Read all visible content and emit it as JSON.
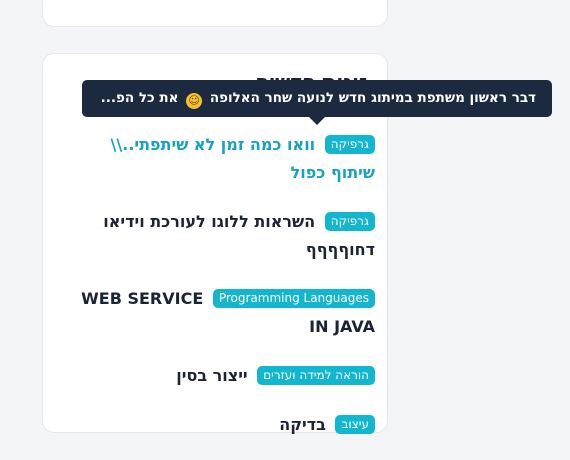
{
  "section": {
    "heading": "זוגות חדשים"
  },
  "tooltip": {
    "text_before_emoji": "דבר ראשון משתפת במיתוג חדש לנועה שחר האלופה",
    "emoji": "☺",
    "text_after_emoji": "את כל הפ..."
  },
  "items": [
    {
      "tag": "גרפיקה",
      "title": "וואו כמה זמן לא שיתפתי..\\\\ שיתוף כפול"
    },
    {
      "tag": "גרפיקה",
      "title": "השראות ללוגו לעורכת וידיאו דחוףףףף"
    },
    {
      "tag": "Programming Languages",
      "title": "WEB SERVICE IN JAVA"
    },
    {
      "tag": "הוראה למידה ועזרים",
      "title": "ייצור בסין"
    },
    {
      "tag": "עיצוב",
      "title": "בדיקה"
    }
  ],
  "colors": {
    "tag_bg": "#13b6cf",
    "link_teal": "#17a2c0",
    "tooltip_bg": "#1c2a40",
    "heading": "#1c2433"
  }
}
